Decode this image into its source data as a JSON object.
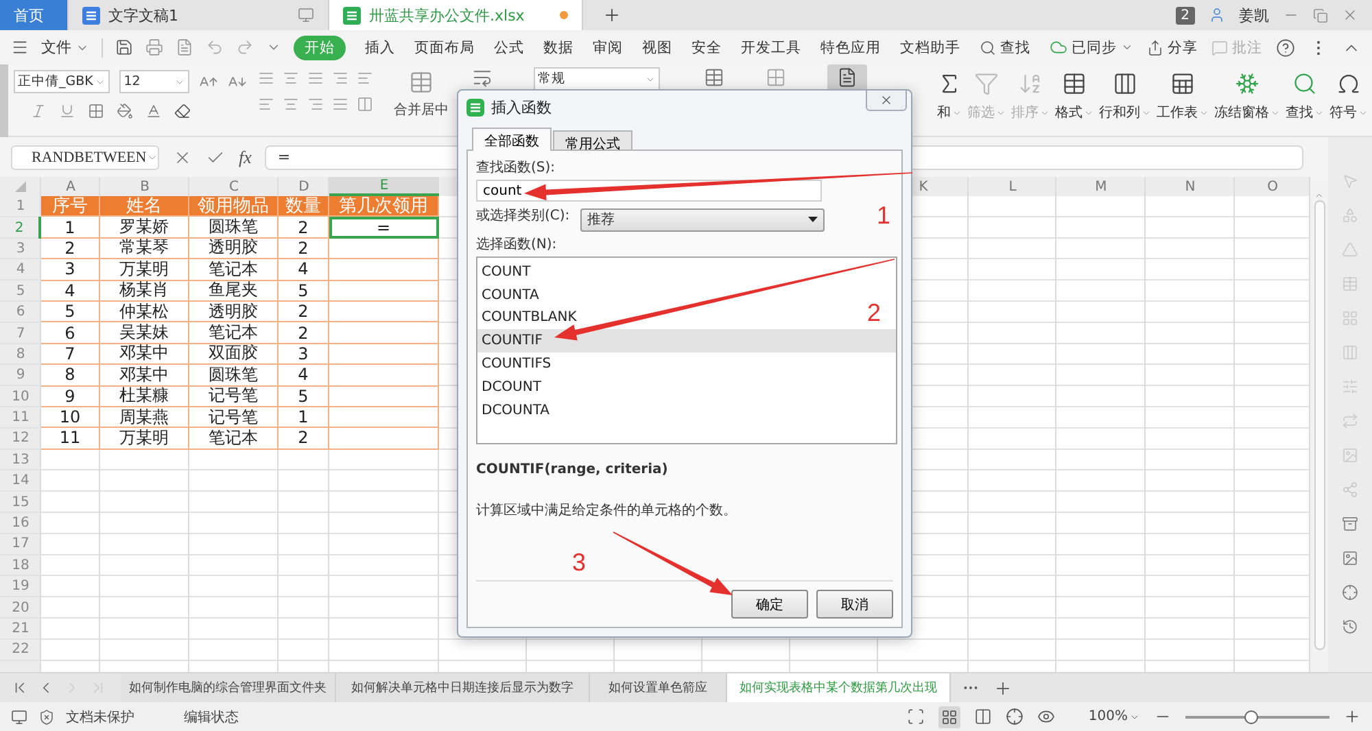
{
  "title_bar": {
    "tabs": [
      {
        "kind": "home",
        "label": "首页",
        "selected": false
      },
      {
        "kind": "writer",
        "label": "文字文稿1",
        "selected": false
      },
      {
        "kind": "sheet",
        "label": "卅蓝共享办公文件.xlsx",
        "selected": true
      }
    ],
    "badge": "2",
    "user": "姜凯"
  },
  "menu": {
    "file": "文件",
    "items": [
      {
        "label": "开始",
        "selected": true
      },
      {
        "label": "插入",
        "selected": false
      },
      {
        "label": "页面布局",
        "selected": false
      },
      {
        "label": "公式",
        "selected": false
      },
      {
        "label": "数据",
        "selected": false
      },
      {
        "label": "审阅",
        "selected": false
      },
      {
        "label": "视图",
        "selected": false
      },
      {
        "label": "安全",
        "selected": false
      },
      {
        "label": "开发工具",
        "selected": false
      },
      {
        "label": "特色应用",
        "selected": false
      },
      {
        "label": "文档助手",
        "selected": false
      }
    ],
    "search": "查找",
    "sync": "已同步",
    "share": "分享",
    "comment": {
      "label": "批注",
      "disabled": true
    }
  },
  "ribbon": {
    "font": "正中倩_GBK",
    "font_size": "12",
    "merge_label": "合并居中",
    "number_format": "常规",
    "tools": [
      {
        "kind": "sum",
        "label": "和",
        "disabled": false
      },
      {
        "kind": "filter",
        "label": "筛选",
        "disabled": true
      },
      {
        "kind": "sort",
        "label": "排序",
        "disabled": true
      },
      {
        "kind": "format",
        "label": "格式",
        "disabled": false
      },
      {
        "kind": "rowcol",
        "label": "行和列",
        "disabled": false
      },
      {
        "kind": "sheet",
        "label": "工作表",
        "disabled": false
      },
      {
        "kind": "freeze",
        "label": "冻结窗格",
        "disabled": false
      },
      {
        "kind": "find",
        "label": "查找",
        "disabled": false
      },
      {
        "kind": "symbol",
        "label": "符号",
        "disabled": false
      }
    ]
  },
  "formula_bar": {
    "name_box": "RANDBETWEEN",
    "fx": "fx",
    "value": "="
  },
  "sheet": {
    "columns_left": [
      "A",
      "B",
      "C",
      "D",
      "E"
    ],
    "columns_right": [
      "K",
      "L",
      "M",
      "N",
      "O"
    ],
    "row_numbers": [
      "1",
      "2",
      "3",
      "4",
      "5",
      "6",
      "7",
      "8",
      "9",
      "10",
      "11",
      "12",
      "13",
      "14",
      "15",
      "16",
      "17",
      "18",
      "19",
      "20",
      "21",
      "22"
    ],
    "header": [
      "序号",
      "姓名",
      "领用物品",
      "数量",
      "第几次领用"
    ],
    "rows": [
      {
        "cells": [
          "1",
          "罗某娇",
          "圆珠笔",
          "2",
          "="
        ],
        "selected": true
      },
      {
        "cells": [
          "2",
          "常某琴",
          "透明胶",
          "2",
          ""
        ],
        "selected": false
      },
      {
        "cells": [
          "3",
          "万某明",
          "笔记本",
          "4",
          ""
        ],
        "selected": false
      },
      {
        "cells": [
          "4",
          "杨某肖",
          "鱼尾夹",
          "5",
          ""
        ],
        "selected": false
      },
      {
        "cells": [
          "5",
          "仲某松",
          "透明胶",
          "2",
          ""
        ],
        "selected": false
      },
      {
        "cells": [
          "6",
          "吴某妹",
          "笔记本",
          "2",
          ""
        ],
        "selected": false
      },
      {
        "cells": [
          "7",
          "邓某中",
          "双面胶",
          "3",
          ""
        ],
        "selected": false
      },
      {
        "cells": [
          "8",
          "邓某中",
          "圆珠笔",
          "4",
          ""
        ],
        "selected": false
      },
      {
        "cells": [
          "9",
          "杜某糠",
          "记号笔",
          "5",
          ""
        ],
        "selected": false
      },
      {
        "cells": [
          "10",
          "周某燕",
          "记号笔",
          "1",
          ""
        ],
        "selected": false
      },
      {
        "cells": [
          "11",
          "万某明",
          "笔记本",
          "2",
          ""
        ],
        "selected": false
      }
    ]
  },
  "dialog": {
    "title": "插入函数",
    "tabs": [
      {
        "label": "全部函数",
        "selected": true
      },
      {
        "label": "常用公式",
        "selected": false
      }
    ],
    "search_label": "查找函数(S):",
    "search_value": "count",
    "category_label": "或选择类别(C):",
    "category": "推荐",
    "list_label": "选择函数(N):",
    "functions": [
      {
        "label": "COUNT",
        "selected": false
      },
      {
        "label": "COUNTA",
        "selected": false
      },
      {
        "label": "COUNTBLANK",
        "selected": false
      },
      {
        "label": "COUNTIF",
        "selected": true
      },
      {
        "label": "COUNTIFS",
        "selected": false
      },
      {
        "label": "DCOUNT",
        "selected": false
      },
      {
        "label": "DCOUNTA",
        "selected": false
      }
    ],
    "signature": "COUNTIF(range, criteria)",
    "description": "计算区域中满足给定条件的单元格的个数。",
    "buttons": [
      "确定",
      "取消"
    ]
  },
  "annotations": [
    {
      "label": "1"
    },
    {
      "label": "2"
    },
    {
      "label": "3"
    }
  ],
  "sheet_tabs": [
    {
      "label": "如何制作电脑的综合管理界面文件夹",
      "selected": false
    },
    {
      "label": "如何解决单元格中日期连接后显示为数字",
      "selected": false
    },
    {
      "label": "如何设置单色箭应",
      "selected": false
    },
    {
      "label": "如何实现表格中某个数据第几次出现",
      "selected": true
    }
  ],
  "status_bar": {
    "protection": "文档未保护",
    "mode": "编辑状态",
    "zoom": "100%",
    "zoom_slider": {
      "level": 0.46
    }
  }
}
